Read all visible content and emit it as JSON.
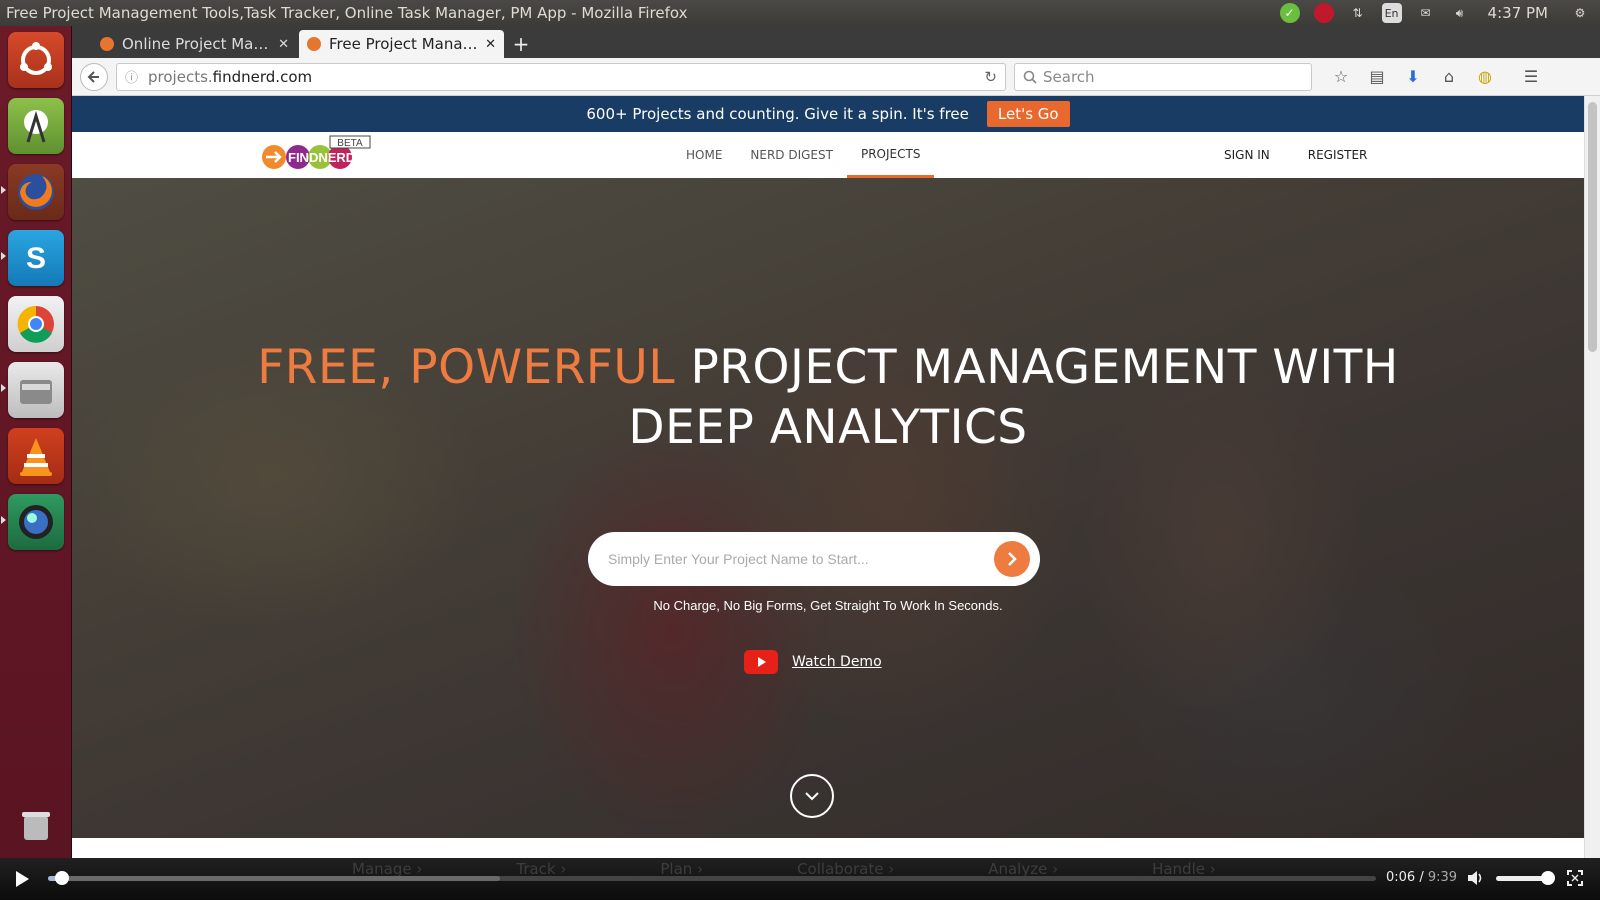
{
  "window": {
    "title": "Free Project Management Tools,Task Tracker, Online Task Manager, PM App - Mozilla Firefox"
  },
  "tray": {
    "keyboard": "En",
    "clock": "4:37 PM"
  },
  "launcher": {
    "items": [
      "ubuntu-dash-icon",
      "android-studio-icon",
      "firefox-icon",
      "skype-icon",
      "chrome-icon",
      "files-icon",
      "vlc-icon",
      "globe-icon",
      "trash-icon"
    ]
  },
  "browser": {
    "tabs": [
      {
        "label": "Online Project Ma…",
        "active": false
      },
      {
        "label": "Free Project Mana…",
        "active": true
      }
    ],
    "url_prefix": "projects.",
    "url_domain": "findnerd.com",
    "search_placeholder": "Search"
  },
  "page": {
    "promo": {
      "text": "600+ Projects and counting. Give it a spin. It's free",
      "cta": "Let's Go"
    },
    "logo": {
      "beta": "BETA",
      "brand": "FINDNERD"
    },
    "nav": [
      {
        "label": "HOME",
        "active": false
      },
      {
        "label": "NERD DIGEST",
        "active": false
      },
      {
        "label": "PROJECTS",
        "active": true
      }
    ],
    "auth": {
      "sign_in": "SIGN IN",
      "register": "REGISTER"
    },
    "hero": {
      "headline_accent": "FREE, POWERFUL",
      "headline_line1": "PROJECT MANAGEMENT WITH",
      "headline_line2": "DEEP ANALYTICS",
      "input_placeholder": "Simply Enter Your Project Name to Start...",
      "subtext": "No Charge, No Big Forms, Get Straight To Work In Seconds.",
      "demo_label": "Watch Demo"
    },
    "ghost_tabs": [
      "Manage ›",
      "Track ›",
      "Plan ›",
      "Collaborate ›",
      "Analyze ›",
      "Handle ›"
    ]
  },
  "player": {
    "current": "0:06",
    "total": "9:39",
    "progress_fraction": 0.0104,
    "buffered_fraction": 0.34,
    "volume_fraction": 1.0
  },
  "colors": {
    "accent": "#ee7b40",
    "promo_bg": "#183c63",
    "launcher": "#6b1a28"
  }
}
